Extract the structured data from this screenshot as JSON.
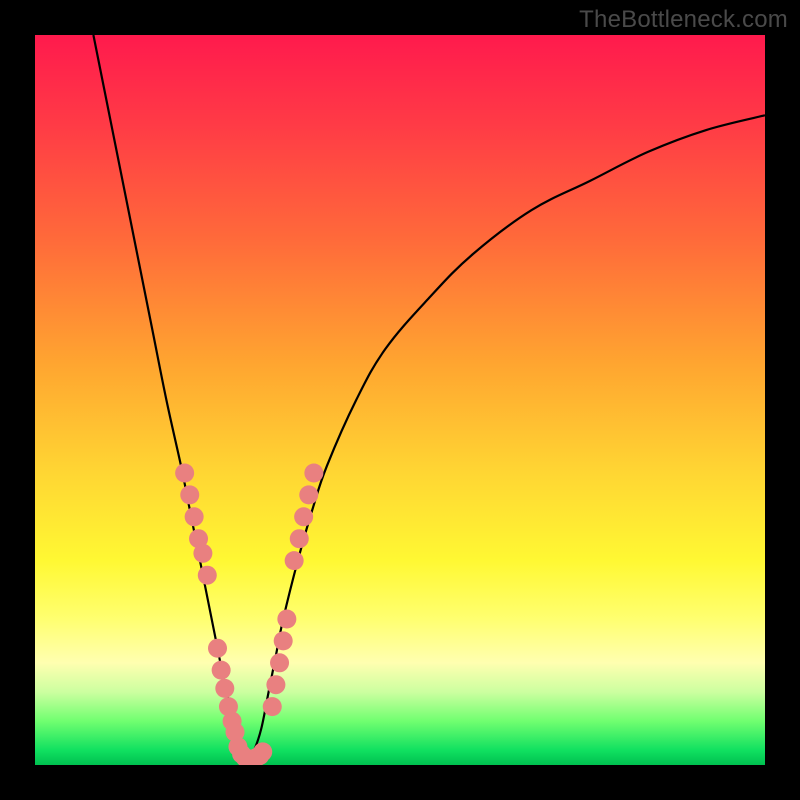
{
  "watermark": "TheBottleneck.com",
  "colors": {
    "frame": "#000000",
    "curve_stroke": "#000000",
    "dot_fill": "#e98080",
    "gradient_top": "#ff1a4d",
    "gradient_bottom": "#00c050"
  },
  "chart_data": {
    "type": "line",
    "title": "",
    "xlabel": "",
    "ylabel": "",
    "xlim": [
      0,
      100
    ],
    "ylim": [
      0,
      100
    ],
    "series": [
      {
        "name": "left-branch",
        "x": [
          8,
          10,
          12,
          14,
          16,
          18,
          20,
          21,
          22,
          23,
          24,
          25,
          26,
          27,
          28,
          29
        ],
        "y": [
          100,
          90,
          80,
          70,
          60,
          50,
          41,
          36,
          31,
          26,
          21,
          16,
          11,
          7,
          3,
          0.5
        ]
      },
      {
        "name": "right-branch",
        "x": [
          29,
          30,
          31,
          32,
          33,
          34,
          36,
          38,
          40,
          44,
          48,
          54,
          60,
          68,
          76,
          84,
          92,
          100
        ],
        "y": [
          0.5,
          2,
          5,
          10,
          15,
          20,
          28,
          35,
          41,
          50,
          57,
          64,
          70,
          76,
          80,
          84,
          87,
          89
        ]
      }
    ],
    "scatter": [
      {
        "name": "left-cluster-upper",
        "points": [
          [
            20.5,
            40
          ],
          [
            21.2,
            37
          ],
          [
            21.8,
            34
          ],
          [
            22.4,
            31
          ],
          [
            23.0,
            29
          ],
          [
            23.6,
            26
          ]
        ]
      },
      {
        "name": "left-cluster-lower",
        "points": [
          [
            25.0,
            16
          ],
          [
            25.5,
            13
          ],
          [
            26.0,
            10.5
          ],
          [
            26.5,
            8
          ],
          [
            27.0,
            6
          ],
          [
            27.4,
            4.5
          ]
        ]
      },
      {
        "name": "valley",
        "points": [
          [
            27.8,
            2.5
          ],
          [
            28.3,
            1.5
          ],
          [
            28.8,
            1.0
          ],
          [
            29.3,
            0.8
          ],
          [
            29.8,
            0.8
          ],
          [
            30.3,
            1.0
          ],
          [
            30.8,
            1.3
          ],
          [
            31.2,
            1.8
          ]
        ]
      },
      {
        "name": "right-cluster-lower",
        "points": [
          [
            32.5,
            8
          ],
          [
            33.0,
            11
          ],
          [
            33.5,
            14
          ],
          [
            34.0,
            17
          ],
          [
            34.5,
            20
          ]
        ]
      },
      {
        "name": "right-cluster-upper",
        "points": [
          [
            35.5,
            28
          ],
          [
            36.2,
            31
          ],
          [
            36.8,
            34
          ],
          [
            37.5,
            37
          ],
          [
            38.2,
            40
          ]
        ]
      }
    ],
    "legend": false,
    "grid": false
  }
}
